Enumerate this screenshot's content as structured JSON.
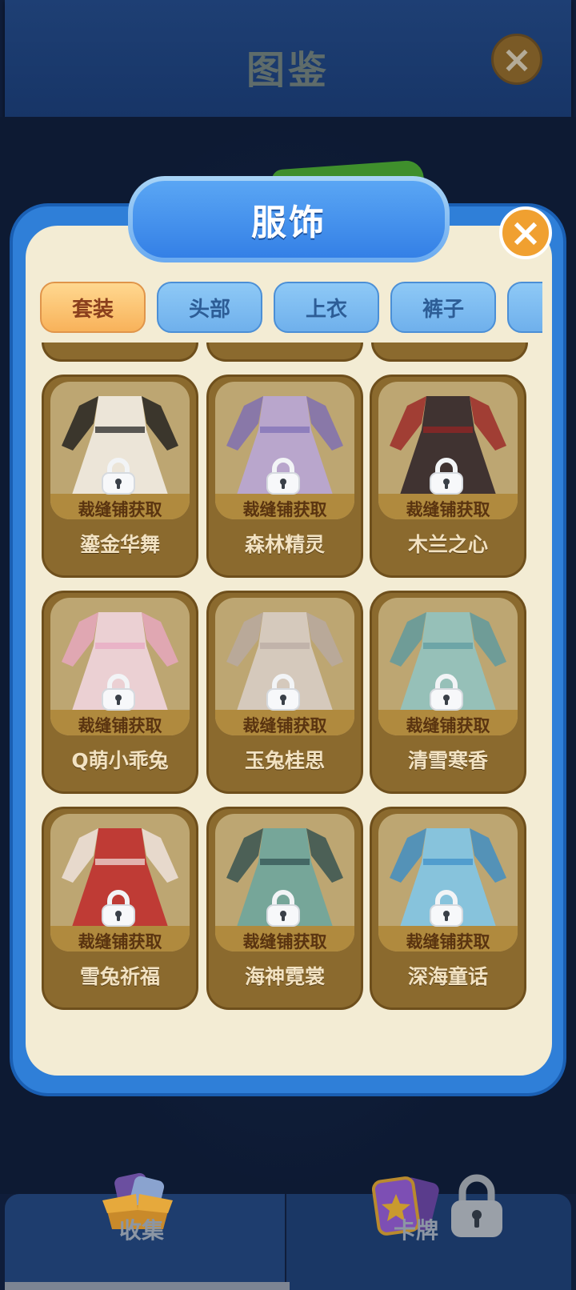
{
  "header": {
    "title": "图鉴",
    "close_icon": "close-icon"
  },
  "modal": {
    "title": "服饰",
    "close_icon": "close-icon"
  },
  "tabs": [
    {
      "label": "套装",
      "active": true
    },
    {
      "label": "头部",
      "active": false
    },
    {
      "label": "上衣",
      "active": false
    },
    {
      "label": "裤子",
      "active": false
    },
    {
      "label": "",
      "active": false
    }
  ],
  "items": [
    {
      "name": "鎏金华舞",
      "acquire": "裁缝铺获取",
      "locked": true,
      "colors": [
        "#f4f0ea",
        "#1a1a1a"
      ]
    },
    {
      "name": "森林精灵",
      "acquire": "裁缝铺获取",
      "locked": true,
      "colors": [
        "#b9a6dc",
        "#7c6db5"
      ]
    },
    {
      "name": "木兰之心",
      "acquire": "裁缝铺获取",
      "locked": true,
      "colors": [
        "#2a1f26",
        "#9a2424"
      ]
    },
    {
      "name": "Q萌小乖兔",
      "acquire": "裁缝铺获取",
      "locked": true,
      "colors": [
        "#f3d7e4",
        "#e8a7c2"
      ]
    },
    {
      "name": "玉兔桂思",
      "acquire": "裁缝铺获取",
      "locked": true,
      "colors": [
        "#d9cfc9",
        "#b8aaa3"
      ]
    },
    {
      "name": "清雪寒香",
      "acquire": "裁缝铺获取",
      "locked": true,
      "colors": [
        "#8fc4c4",
        "#5b9aa0"
      ]
    },
    {
      "name": "雪兔祈福",
      "acquire": "裁缝铺获取",
      "locked": true,
      "colors": [
        "#c0282a",
        "#f1e6e2"
      ]
    },
    {
      "name": "海神霓裳",
      "acquire": "裁缝铺获取",
      "locked": true,
      "colors": [
        "#6aa6a0",
        "#2f4f4f"
      ]
    },
    {
      "name": "深海童话",
      "acquire": "裁缝铺获取",
      "locked": true,
      "colors": [
        "#7ec8ee",
        "#3a8dc8"
      ]
    }
  ],
  "bottom_nav": [
    {
      "label": "收集",
      "icon": "collection-box-icon"
    },
    {
      "label": "卡牌",
      "icon": "card-star-icon"
    }
  ]
}
